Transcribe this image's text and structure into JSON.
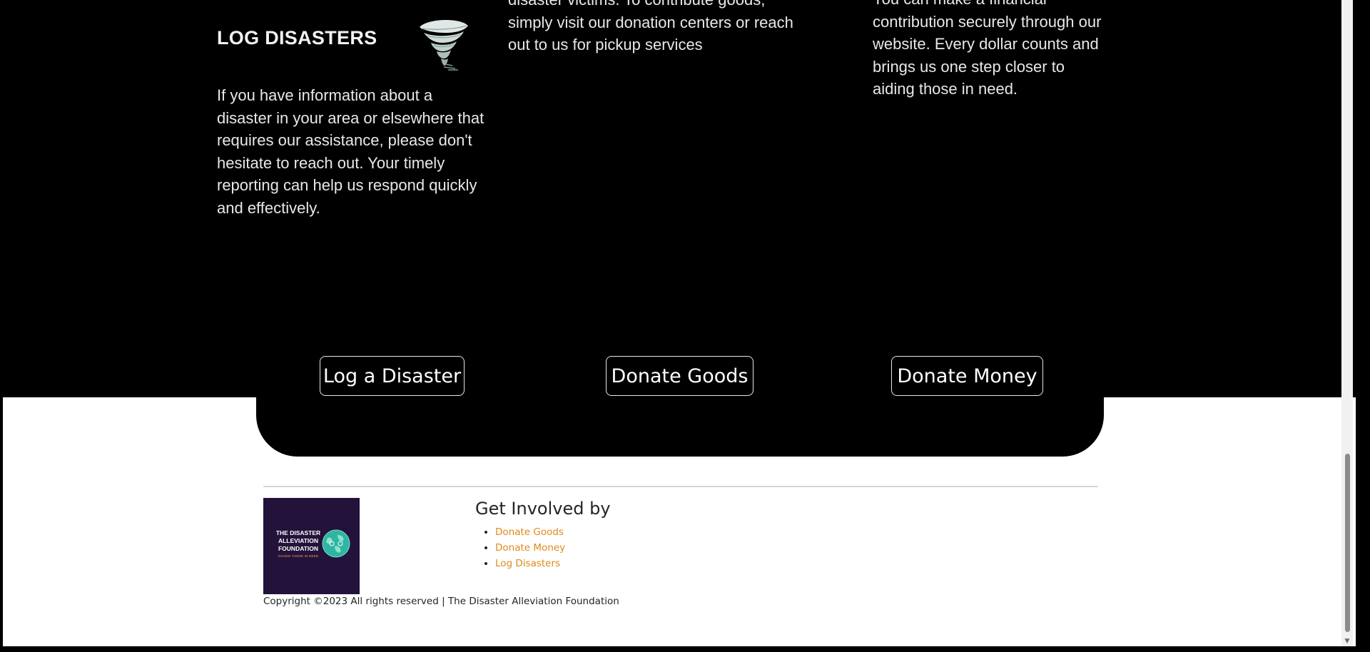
{
  "sections": {
    "log": {
      "heading": "LOG DISASTERS",
      "lines": [
        "If you have information about a",
        "disaster in your area or elsewhere that",
        "requires our assistance, please don't",
        "hesitate to reach out. Your timely",
        "reporting can help us respond quickly",
        "and effectively."
      ],
      "icon": "tornado-icon"
    },
    "goods": {
      "lines": [
        "disaster victims. To contribute goods,",
        "simply visit our donation centers or reach",
        "out to us for pickup services"
      ]
    },
    "money": {
      "lines": [
        "You can make a financial",
        "contribution securely through our",
        "website. Every dollar counts and",
        "brings us one step closer to",
        "aiding those in need."
      ]
    }
  },
  "buttons": {
    "log": "Log a Disaster",
    "goods": "Donate Goods",
    "money": "Donate Money"
  },
  "footer": {
    "logo": {
      "title_lines": [
        "THE DISASTER",
        "ALLEVIATION",
        "FOUNDATION"
      ],
      "tagline": "SAVING THOSE IN NEED"
    },
    "get_involved_heading": "Get Involved by",
    "links": [
      "Donate Goods",
      "Donate Money",
      "Log Disasters"
    ],
    "copyright": "Copyright ©2023 All rights reserved | The Disaster Alleviation Foundation"
  },
  "colors": {
    "band": "#000000",
    "link": "#e0891a",
    "logo_bg": "#23123a",
    "footer_text": "#212529"
  }
}
